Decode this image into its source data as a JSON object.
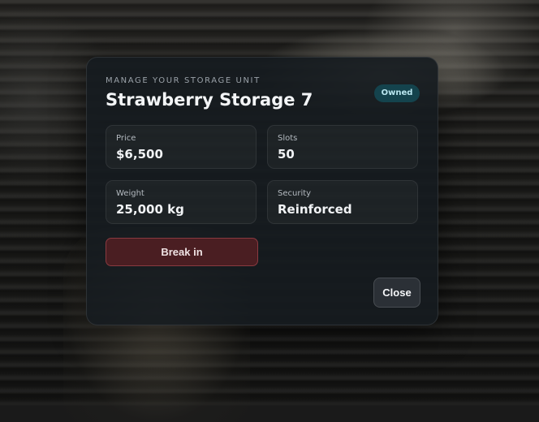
{
  "modal": {
    "subtitle": "MANAGE YOUR STORAGE UNIT",
    "title": "Strawberry Storage 7",
    "badge": "Owned",
    "stats": [
      {
        "label": "Price",
        "value": "$6,500"
      },
      {
        "label": "Slots",
        "value": "50"
      },
      {
        "label": "Weight",
        "value": "25,000 kg"
      },
      {
        "label": "Security",
        "value": "Reinforced"
      }
    ],
    "break_in_label": "Break in",
    "close_label": "Close"
  },
  "colors": {
    "danger_button": "#4a1e22",
    "badge_bg": "#14434d",
    "modal_bg": "#161b20"
  }
}
